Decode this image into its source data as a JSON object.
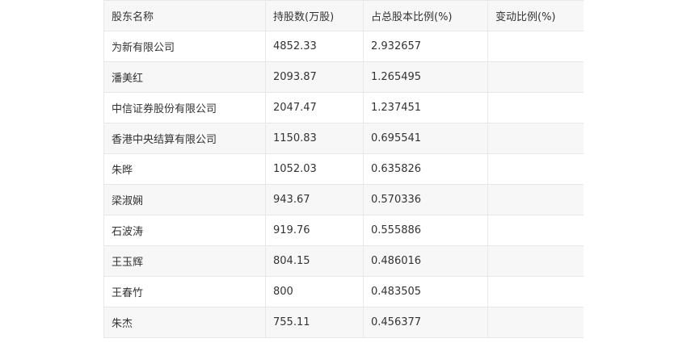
{
  "table": {
    "headers": [
      "股东名称",
      "持股数(万股)",
      "占总股本比例(%)",
      "变动比例(%)"
    ],
    "rows": [
      {
        "name": "为新有限公司",
        "shares": "4852.33",
        "ratio": "2.932657",
        "change": ""
      },
      {
        "name": "潘美红",
        "shares": "2093.87",
        "ratio": "1.265495",
        "change": ""
      },
      {
        "name": "中信证券股份有限公司",
        "shares": "2047.47",
        "ratio": "1.237451",
        "change": ""
      },
      {
        "name": "香港中央结算有限公司",
        "shares": "1150.83",
        "ratio": "0.695541",
        "change": ""
      },
      {
        "name": "朱晔",
        "shares": "1052.03",
        "ratio": "0.635826",
        "change": ""
      },
      {
        "name": "梁淑娴",
        "shares": "943.67",
        "ratio": "0.570336",
        "change": ""
      },
      {
        "name": "石波涛",
        "shares": "919.76",
        "ratio": "0.555886",
        "change": ""
      },
      {
        "name": "王玉辉",
        "shares": "804.15",
        "ratio": "0.486016",
        "change": ""
      },
      {
        "name": "王春竹",
        "shares": "800",
        "ratio": "0.483505",
        "change": ""
      },
      {
        "name": "朱杰",
        "shares": "755.11",
        "ratio": "0.456377",
        "change": ""
      }
    ]
  }
}
